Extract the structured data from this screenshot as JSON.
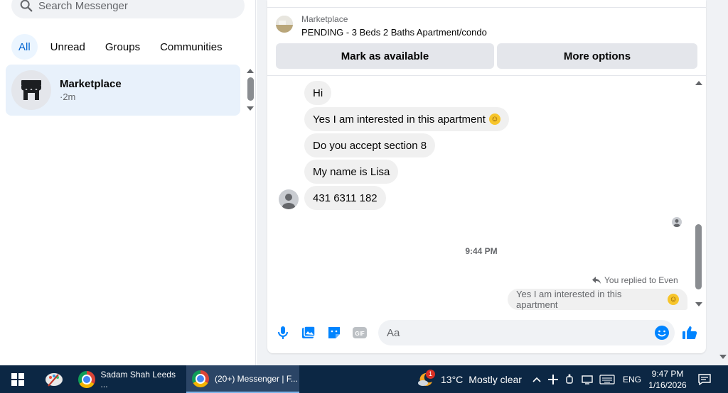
{
  "search": {
    "placeholder": "Search Messenger"
  },
  "filters": [
    "All",
    "Unread",
    "Groups",
    "Communities"
  ],
  "conversations": [
    {
      "name": "Marketplace",
      "time": "·2m"
    }
  ],
  "listing": {
    "source": "Marketplace",
    "title": "PENDING - 3 Beds 2 Baths Apartment/condo",
    "actions": [
      "Mark as available",
      "More options"
    ]
  },
  "messages": [
    {
      "text": "Hi",
      "emoji": false
    },
    {
      "text": "Yes I am interested in this apartment",
      "emoji": true
    },
    {
      "text": "Do you accept section 8",
      "emoji": false
    },
    {
      "text": "My name is Lisa",
      "emoji": false
    },
    {
      "text": "431 6311 182",
      "emoji": false
    }
  ],
  "timestamp": "9:44 PM",
  "reply": {
    "note": "You replied to Even",
    "quote": "Yes I am interested in this apartment"
  },
  "composer": {
    "placeholder": "Aa",
    "icons": [
      "microphone-icon",
      "photo-icon",
      "sticker-icon",
      "gif-icon",
      "emoji-icon",
      "like-icon"
    ]
  },
  "taskbar": {
    "apps": [
      {
        "label": "Sadam Shah Leeds ...",
        "active": false
      },
      {
        "label": "(20+) Messenger | F...",
        "active": true
      }
    ],
    "weather": {
      "temp": "13°C",
      "condition": "Mostly clear",
      "badge": "1"
    },
    "language": "ENG",
    "time": "9:47 PM",
    "date": "1/16/2026"
  },
  "colors": {
    "accent": "#0084ff",
    "active_filter_bg": "#ebf5ff",
    "taskbar_bg": "#0c2744"
  }
}
